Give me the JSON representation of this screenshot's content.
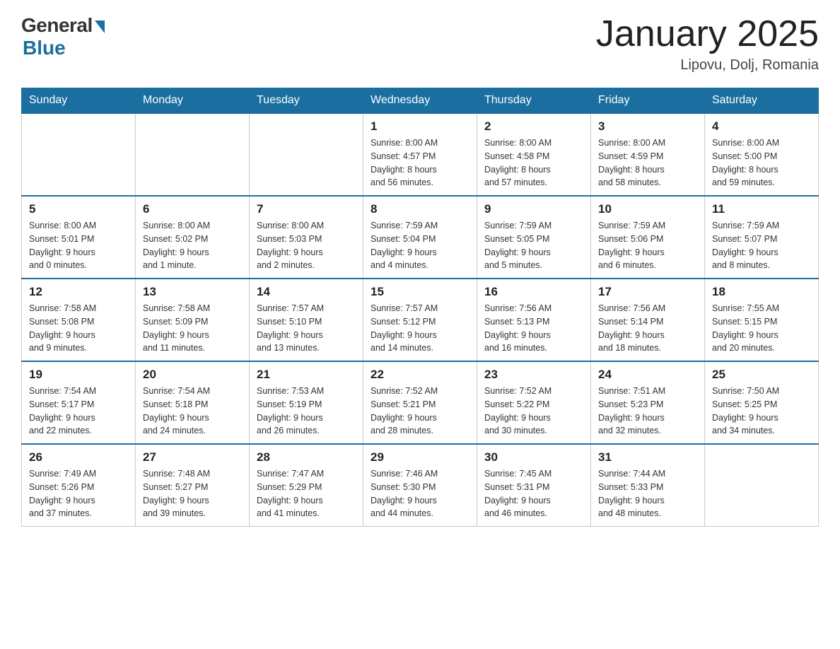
{
  "header": {
    "logo_general": "General",
    "logo_blue": "Blue",
    "month_title": "January 2025",
    "location": "Lipovu, Dolj, Romania"
  },
  "calendar": {
    "days_of_week": [
      "Sunday",
      "Monday",
      "Tuesday",
      "Wednesday",
      "Thursday",
      "Friday",
      "Saturday"
    ],
    "weeks": [
      [
        {
          "day": "",
          "info": ""
        },
        {
          "day": "",
          "info": ""
        },
        {
          "day": "",
          "info": ""
        },
        {
          "day": "1",
          "info": "Sunrise: 8:00 AM\nSunset: 4:57 PM\nDaylight: 8 hours\nand 56 minutes."
        },
        {
          "day": "2",
          "info": "Sunrise: 8:00 AM\nSunset: 4:58 PM\nDaylight: 8 hours\nand 57 minutes."
        },
        {
          "day": "3",
          "info": "Sunrise: 8:00 AM\nSunset: 4:59 PM\nDaylight: 8 hours\nand 58 minutes."
        },
        {
          "day": "4",
          "info": "Sunrise: 8:00 AM\nSunset: 5:00 PM\nDaylight: 8 hours\nand 59 minutes."
        }
      ],
      [
        {
          "day": "5",
          "info": "Sunrise: 8:00 AM\nSunset: 5:01 PM\nDaylight: 9 hours\nand 0 minutes."
        },
        {
          "day": "6",
          "info": "Sunrise: 8:00 AM\nSunset: 5:02 PM\nDaylight: 9 hours\nand 1 minute."
        },
        {
          "day": "7",
          "info": "Sunrise: 8:00 AM\nSunset: 5:03 PM\nDaylight: 9 hours\nand 2 minutes."
        },
        {
          "day": "8",
          "info": "Sunrise: 7:59 AM\nSunset: 5:04 PM\nDaylight: 9 hours\nand 4 minutes."
        },
        {
          "day": "9",
          "info": "Sunrise: 7:59 AM\nSunset: 5:05 PM\nDaylight: 9 hours\nand 5 minutes."
        },
        {
          "day": "10",
          "info": "Sunrise: 7:59 AM\nSunset: 5:06 PM\nDaylight: 9 hours\nand 6 minutes."
        },
        {
          "day": "11",
          "info": "Sunrise: 7:59 AM\nSunset: 5:07 PM\nDaylight: 9 hours\nand 8 minutes."
        }
      ],
      [
        {
          "day": "12",
          "info": "Sunrise: 7:58 AM\nSunset: 5:08 PM\nDaylight: 9 hours\nand 9 minutes."
        },
        {
          "day": "13",
          "info": "Sunrise: 7:58 AM\nSunset: 5:09 PM\nDaylight: 9 hours\nand 11 minutes."
        },
        {
          "day": "14",
          "info": "Sunrise: 7:57 AM\nSunset: 5:10 PM\nDaylight: 9 hours\nand 13 minutes."
        },
        {
          "day": "15",
          "info": "Sunrise: 7:57 AM\nSunset: 5:12 PM\nDaylight: 9 hours\nand 14 minutes."
        },
        {
          "day": "16",
          "info": "Sunrise: 7:56 AM\nSunset: 5:13 PM\nDaylight: 9 hours\nand 16 minutes."
        },
        {
          "day": "17",
          "info": "Sunrise: 7:56 AM\nSunset: 5:14 PM\nDaylight: 9 hours\nand 18 minutes."
        },
        {
          "day": "18",
          "info": "Sunrise: 7:55 AM\nSunset: 5:15 PM\nDaylight: 9 hours\nand 20 minutes."
        }
      ],
      [
        {
          "day": "19",
          "info": "Sunrise: 7:54 AM\nSunset: 5:17 PM\nDaylight: 9 hours\nand 22 minutes."
        },
        {
          "day": "20",
          "info": "Sunrise: 7:54 AM\nSunset: 5:18 PM\nDaylight: 9 hours\nand 24 minutes."
        },
        {
          "day": "21",
          "info": "Sunrise: 7:53 AM\nSunset: 5:19 PM\nDaylight: 9 hours\nand 26 minutes."
        },
        {
          "day": "22",
          "info": "Sunrise: 7:52 AM\nSunset: 5:21 PM\nDaylight: 9 hours\nand 28 minutes."
        },
        {
          "day": "23",
          "info": "Sunrise: 7:52 AM\nSunset: 5:22 PM\nDaylight: 9 hours\nand 30 minutes."
        },
        {
          "day": "24",
          "info": "Sunrise: 7:51 AM\nSunset: 5:23 PM\nDaylight: 9 hours\nand 32 minutes."
        },
        {
          "day": "25",
          "info": "Sunrise: 7:50 AM\nSunset: 5:25 PM\nDaylight: 9 hours\nand 34 minutes."
        }
      ],
      [
        {
          "day": "26",
          "info": "Sunrise: 7:49 AM\nSunset: 5:26 PM\nDaylight: 9 hours\nand 37 minutes."
        },
        {
          "day": "27",
          "info": "Sunrise: 7:48 AM\nSunset: 5:27 PM\nDaylight: 9 hours\nand 39 minutes."
        },
        {
          "day": "28",
          "info": "Sunrise: 7:47 AM\nSunset: 5:29 PM\nDaylight: 9 hours\nand 41 minutes."
        },
        {
          "day": "29",
          "info": "Sunrise: 7:46 AM\nSunset: 5:30 PM\nDaylight: 9 hours\nand 44 minutes."
        },
        {
          "day": "30",
          "info": "Sunrise: 7:45 AM\nSunset: 5:31 PM\nDaylight: 9 hours\nand 46 minutes."
        },
        {
          "day": "31",
          "info": "Sunrise: 7:44 AM\nSunset: 5:33 PM\nDaylight: 9 hours\nand 48 minutes."
        },
        {
          "day": "",
          "info": ""
        }
      ]
    ]
  }
}
